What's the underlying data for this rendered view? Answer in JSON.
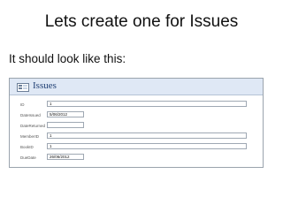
{
  "slide": {
    "title": "Lets create one for Issues",
    "subtitle": "It should look like this:"
  },
  "form": {
    "title": "Issues",
    "icon": "form-icon",
    "fields": [
      {
        "label": "ID",
        "value": "1"
      },
      {
        "label": "DateIssued",
        "value": "5/06/2012"
      },
      {
        "label": "DateReturned",
        "value": ""
      },
      {
        "label": "MemberID",
        "value": "1"
      },
      {
        "label": "BookID",
        "value": "1"
      },
      {
        "label": "DueDate",
        "value": "26/06/2012"
      }
    ]
  },
  "colors": {
    "form_header": "#dfe8f5",
    "form_border": "#9aa3ad",
    "title_text": "#1f3f73"
  }
}
